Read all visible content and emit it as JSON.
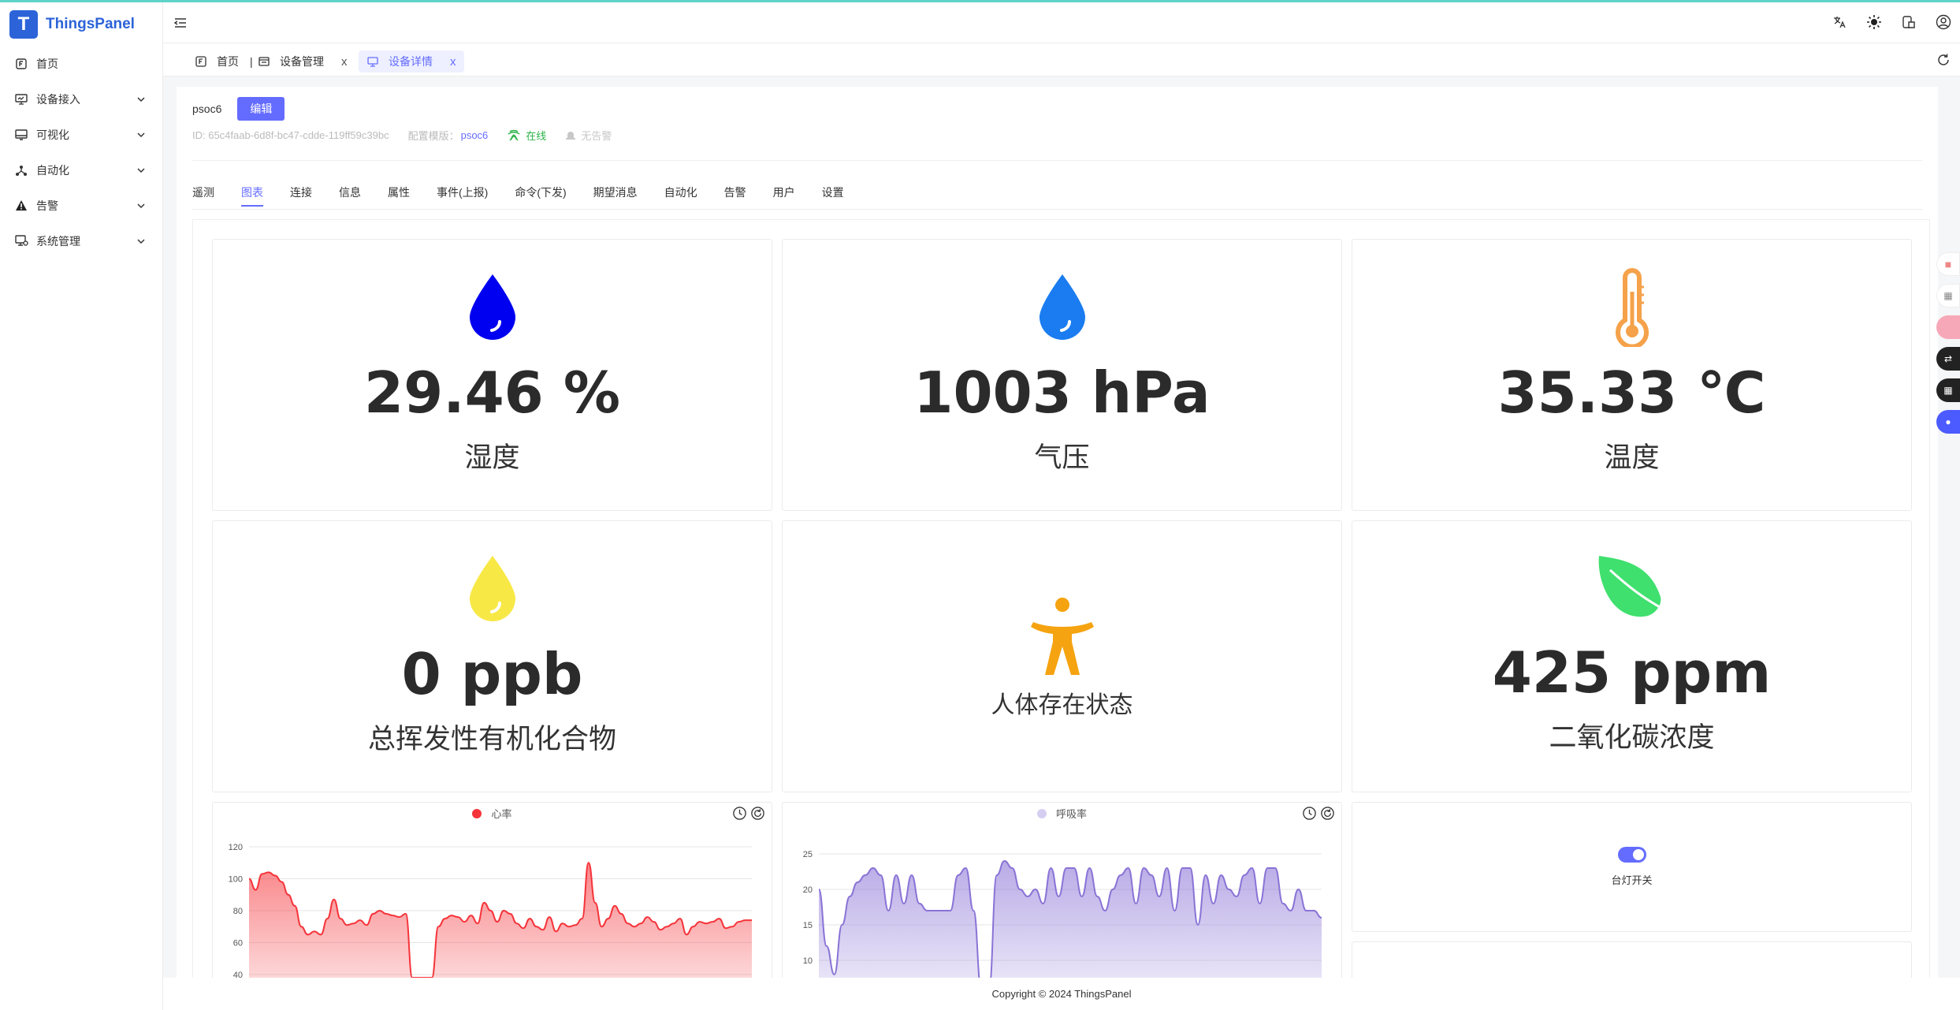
{
  "app": {
    "name": "ThingsPanel",
    "logo_letter": "T"
  },
  "sidebar": {
    "items": [
      {
        "label": "首页",
        "icon": "home-icon",
        "has_children": false
      },
      {
        "label": "设备接入",
        "icon": "device-access-icon",
        "has_children": true
      },
      {
        "label": "可视化",
        "icon": "visualization-icon",
        "has_children": true
      },
      {
        "label": "自动化",
        "icon": "automation-icon",
        "has_children": true
      },
      {
        "label": "告警",
        "icon": "alarm-icon",
        "has_children": true
      },
      {
        "label": "系统管理",
        "icon": "system-management-icon",
        "has_children": true
      }
    ]
  },
  "header": {
    "icons": [
      "translate-icon",
      "theme-sun-icon",
      "theme-config-icon",
      "user-icon"
    ]
  },
  "tabs": [
    {
      "label": "首页",
      "icon": "home-icon",
      "active": false,
      "closable": false
    },
    {
      "label": "设备管理",
      "icon": "device-management-icon",
      "active": false,
      "closable": true
    },
    {
      "label": "设备详情",
      "icon": "device-detail-icon",
      "active": true,
      "closable": true
    }
  ],
  "tab_close_glyph": "x",
  "device": {
    "name": "psoc6",
    "edit_label": "编辑",
    "id_text": "ID: 65c4faab-6d8f-bc47-cdde-119ff59c39bc",
    "config_label": "配置模版：",
    "config_value": "psoc6",
    "status_online": "在线",
    "status_alarm": "无告警"
  },
  "subtabs": [
    {
      "label": "遥测",
      "active": false
    },
    {
      "label": "图表",
      "active": true
    },
    {
      "label": "连接",
      "active": false
    },
    {
      "label": "信息",
      "active": false
    },
    {
      "label": "属性",
      "active": false
    },
    {
      "label": "事件(上报)",
      "active": false
    },
    {
      "label": "命令(下发)",
      "active": false
    },
    {
      "label": "期望消息",
      "active": false
    },
    {
      "label": "自动化",
      "active": false
    },
    {
      "label": "告警",
      "active": false
    },
    {
      "label": "用户",
      "active": false
    },
    {
      "label": "设置",
      "active": false
    }
  ],
  "cards": {
    "humidity": {
      "value": "29.46 %",
      "label": "湿度",
      "icon": "water-drop-icon",
      "color": "#0000f0"
    },
    "pressure": {
      "value": "1003 hPa",
      "label": "气压",
      "icon": "water-drop-icon",
      "color": "#1a7cf0"
    },
    "temperature": {
      "value": "35.33 ℃",
      "label": "温度",
      "icon": "thermometer-icon",
      "color": "#f5a24a"
    },
    "voc": {
      "value": "0 ppb",
      "label": "总挥发性有机化合物",
      "icon": "water-drop-icon",
      "color": "#f8e846"
    },
    "presence": {
      "label": "人体存在状态",
      "icon": "person-icon",
      "color": "#f5a310"
    },
    "co2": {
      "value": "425 ppm",
      "label": "二氧化碳浓度",
      "icon": "leaf-icon",
      "color": "#3fe06e"
    },
    "lamp": {
      "label": "台灯开关",
      "state": "on"
    }
  },
  "chart_data": [
    {
      "type": "area",
      "series": [
        {
          "name": "心率",
          "color": "#f5343a"
        }
      ],
      "y_ticks": [
        "40",
        "60",
        "80",
        "100",
        "120"
      ],
      "ylim": [
        40,
        120
      ],
      "values": [
        100,
        93,
        103,
        104,
        102,
        98,
        90,
        83,
        70,
        65,
        67,
        65,
        75,
        87,
        75,
        71,
        72,
        74,
        71,
        78,
        80,
        78,
        77,
        76,
        78,
        38,
        38,
        38,
        38,
        70,
        75,
        77,
        76,
        73,
        77,
        72,
        85,
        80,
        73,
        80,
        78,
        72,
        69,
        75,
        70,
        68,
        76,
        67,
        72,
        70,
        71,
        75,
        110,
        85,
        70,
        75,
        83,
        78,
        72,
        70,
        72,
        76,
        73,
        68,
        70,
        72,
        75,
        65,
        70,
        73,
        72,
        73,
        75,
        69,
        70,
        73,
        74,
        74
      ]
    },
    {
      "type": "area",
      "series": [
        {
          "name": "呼吸率",
          "color": "#8a73d6"
        }
      ],
      "y_ticks": [
        "10",
        "15",
        "20",
        "25"
      ],
      "ylim": [
        8,
        26
      ],
      "values": [
        20,
        12,
        8,
        15,
        19,
        21,
        22,
        23,
        22,
        17,
        22,
        18,
        22,
        18,
        17,
        17,
        17,
        17,
        22,
        23,
        17,
        6,
        6,
        22,
        24,
        23,
        20,
        19,
        20,
        18,
        23,
        19,
        23,
        23,
        19,
        23,
        19,
        17,
        20,
        22,
        23,
        18,
        23,
        22,
        19,
        23,
        17,
        23,
        23,
        15,
        22,
        18,
        22,
        20,
        19,
        22,
        23,
        18,
        23,
        23,
        18,
        17,
        20,
        17,
        17,
        16
      ]
    }
  ],
  "footer": {
    "copyright": "Copyright © 2024 ThingsPanel"
  }
}
